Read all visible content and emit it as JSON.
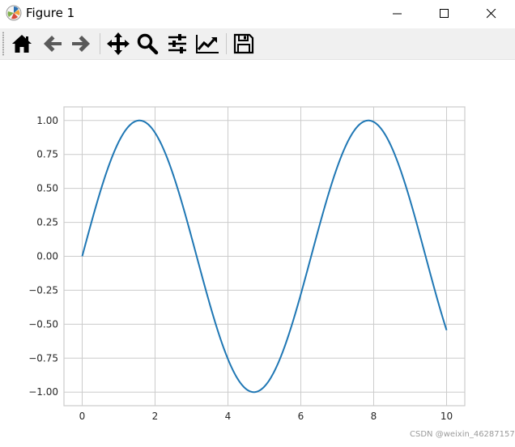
{
  "window": {
    "title": "Figure 1"
  },
  "toolbar": {
    "buttons": [
      {
        "name": "home",
        "icon": "home-icon"
      },
      {
        "name": "back",
        "icon": "arrow-left-icon"
      },
      {
        "name": "forward",
        "icon": "arrow-right-icon"
      },
      {
        "name": "pan",
        "icon": "move-icon"
      },
      {
        "name": "zoom",
        "icon": "magnifier-icon"
      },
      {
        "name": "subplots",
        "icon": "sliders-icon"
      },
      {
        "name": "edit-axes",
        "icon": "line-chart-icon"
      },
      {
        "name": "save",
        "icon": "floppy-disk-icon"
      }
    ]
  },
  "chart_data": {
    "type": "line",
    "function": "sin(x)",
    "x_range": [
      0,
      10
    ],
    "xlim": [
      -0.5,
      10.5
    ],
    "ylim": [
      -1.1,
      1.1
    ],
    "x_ticks": [
      "0",
      "2",
      "4",
      "6",
      "8",
      "10"
    ],
    "y_ticks": [
      "1.00",
      "0.75",
      "0.50",
      "0.25",
      "0.00",
      "−0.25",
      "−0.50",
      "−0.75",
      "−1.00"
    ],
    "x_tick_values": [
      0,
      2,
      4,
      6,
      8,
      10
    ],
    "y_tick_values": [
      1.0,
      0.75,
      0.5,
      0.25,
      0.0,
      -0.25,
      -0.5,
      -0.75,
      -1.0
    ],
    "grid": true,
    "line_color": "#1f77b4",
    "grid_color": "#cccccc",
    "series": [
      {
        "x": [
          0,
          0.5,
          1.0,
          1.5708,
          2.0,
          2.5,
          3.0,
          3.5,
          4.0,
          4.7124,
          5.0,
          5.5,
          6.0,
          6.5,
          7.0,
          7.5,
          7.854,
          8.5,
          9.0,
          9.5,
          10.0
        ],
        "y": [
          0.0,
          0.479,
          0.841,
          1.0,
          0.909,
          0.598,
          0.141,
          -0.351,
          -0.757,
          -1.0,
          -0.959,
          -0.706,
          -0.279,
          0.215,
          0.657,
          0.938,
          1.0,
          0.798,
          0.412,
          -0.075,
          -0.544
        ]
      }
    ]
  },
  "watermark": "CSDN @weixin_46287157"
}
